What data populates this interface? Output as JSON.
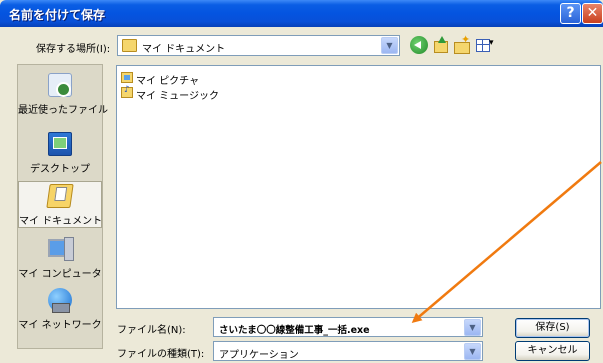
{
  "dialog": {
    "title": "名前を付けて保存",
    "help_glyph": "?",
    "close_glyph": "✕"
  },
  "toolbar": {
    "lookin_label": "保存する場所(I):",
    "lookin_value": "マイ ドキュメント",
    "icons": [
      "back-icon",
      "up-folder-icon",
      "new-folder-icon",
      "views-menu-icon"
    ]
  },
  "places": [
    {
      "label": "最近使ったファイル",
      "icon": "recent-documents-icon"
    },
    {
      "label": "デスクトップ",
      "icon": "desktop-icon"
    },
    {
      "label": "マイ ドキュメント",
      "icon": "my-documents-icon",
      "selected": true
    },
    {
      "label": "マイ コンピュータ",
      "icon": "my-computer-icon"
    },
    {
      "label": "マイ ネットワーク",
      "icon": "my-network-icon"
    }
  ],
  "files": [
    {
      "label": "マイ ピクチャ",
      "icon": "pictures-folder-icon"
    },
    {
      "label": "マイ ミュージック",
      "icon": "music-folder-icon"
    }
  ],
  "bottom": {
    "filename_label": "ファイル名(N):",
    "filename_value": "さいたま〇〇線整備工事_一括.exe",
    "filetype_label": "ファイルの種類(T):",
    "filetype_value": "アプリケーション",
    "save_button": "保存(S)",
    "cancel_button": "キャンセル"
  },
  "colors": {
    "titlebar": "#0454e0",
    "dialog_bg": "#ece9d8",
    "arrow": "#f07a10"
  }
}
